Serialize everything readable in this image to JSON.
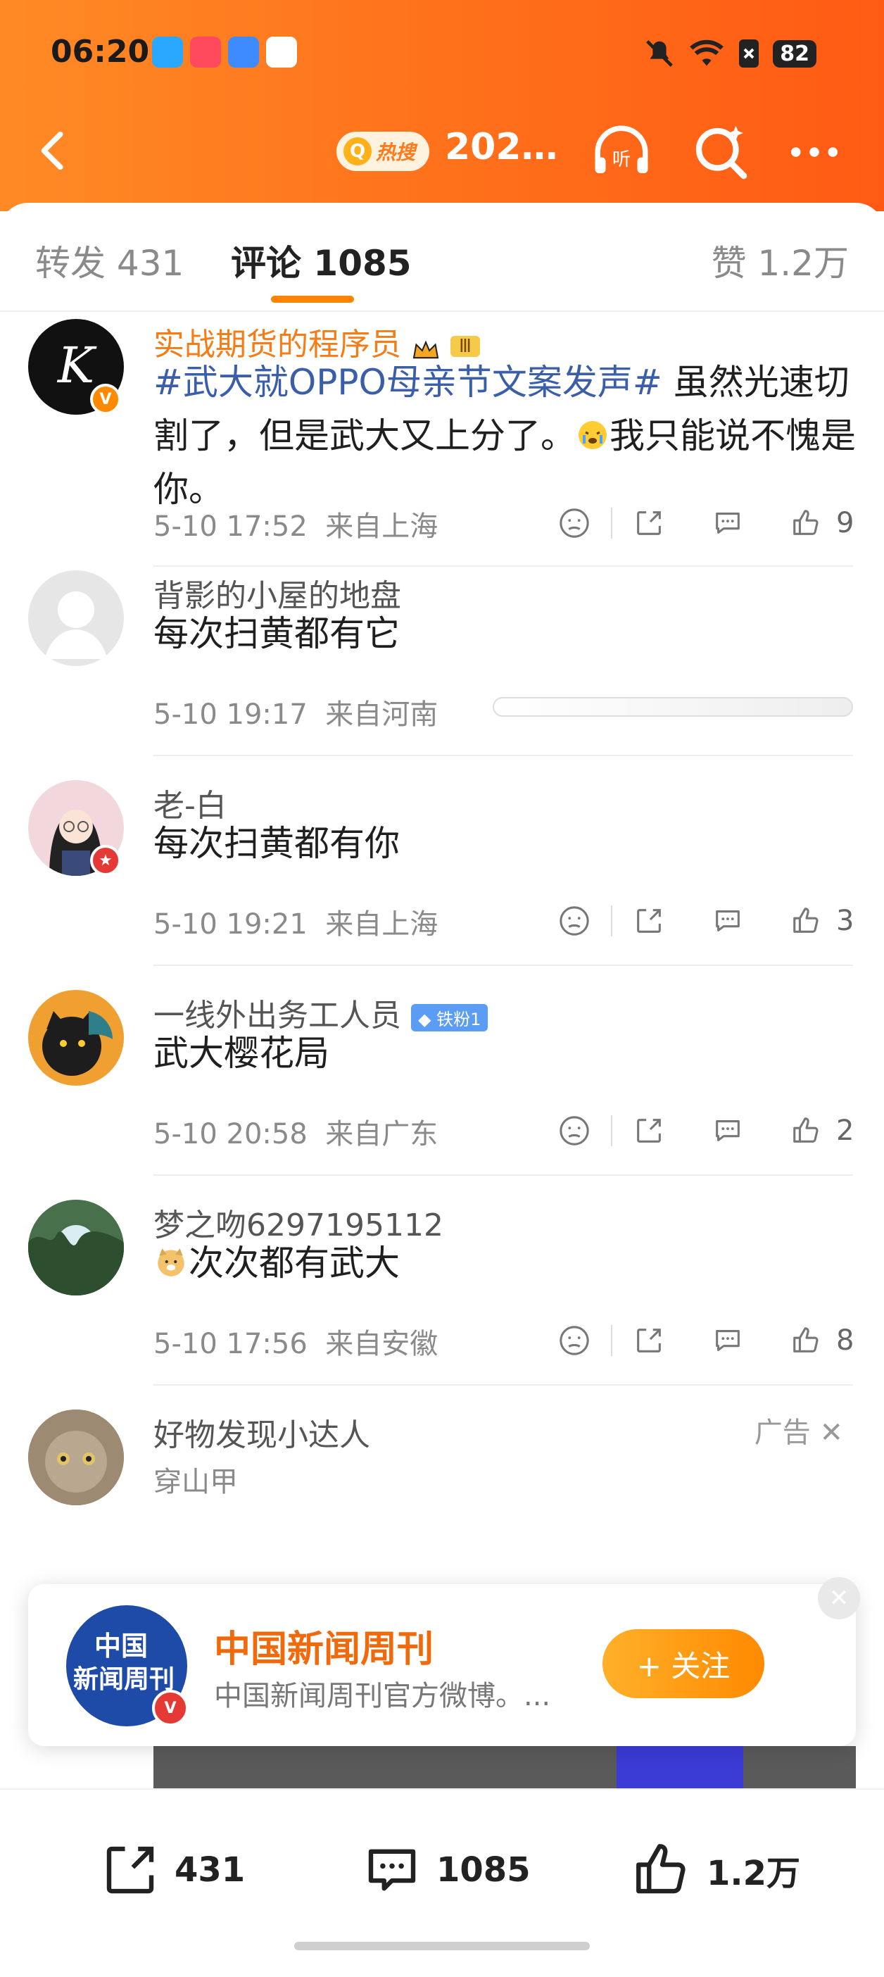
{
  "status_bar": {
    "time": "06:20",
    "battery": "82"
  },
  "header": {
    "hot_label": "热搜",
    "title": "202…"
  },
  "tabs": [
    {
      "label": "转发 431"
    },
    {
      "label": "评论 1085"
    },
    {
      "label": "赞 1.2万"
    }
  ],
  "comments": [
    {
      "user": "实战期货的程序员",
      "level": "Ⅲ",
      "hashtag": "#武大就OPPO母亲节文案发声#",
      "text_a": " 虽然光速切割了，但是武大又上分了。",
      "text_b": "我只能说不愧是你。",
      "time": "5-10 17:52",
      "location": "来自上海",
      "likes": "9"
    },
    {
      "user": "背影的小屋的地盘",
      "text": "每次扫黄都有它",
      "time": "5-10 19:17",
      "location": "来自河南"
    },
    {
      "user": "老-白",
      "text": "每次扫黄都有你",
      "time": "5-10 19:21",
      "location": "来自上海",
      "likes": "3"
    },
    {
      "user": "一线外出务工人员",
      "fan_badge": "铁粉1",
      "text": "武大樱花局",
      "time": "5-10 20:58",
      "location": "来自广东",
      "likes": "2"
    },
    {
      "user": "梦之吻6297195112",
      "text": "次次都有武大",
      "time": "5-10 17:56",
      "location": "来自安徽",
      "likes": "8"
    }
  ],
  "ad": {
    "user": "好物发现小达人",
    "label": "广告",
    "subtitle": "穿山甲"
  },
  "follow_card": {
    "logo_line1": "中国",
    "logo_line2": "新闻周刊",
    "name": "中国新闻周刊",
    "desc": "中国新闻周刊官方微博。...",
    "button": "+ 关注"
  },
  "bottom_bar": {
    "reposts": "431",
    "comments": "1085",
    "likes": "1.2万"
  },
  "colors": {
    "accent": "#ff8200",
    "header": "#ff6f1a",
    "link": "#3b5ea8"
  }
}
